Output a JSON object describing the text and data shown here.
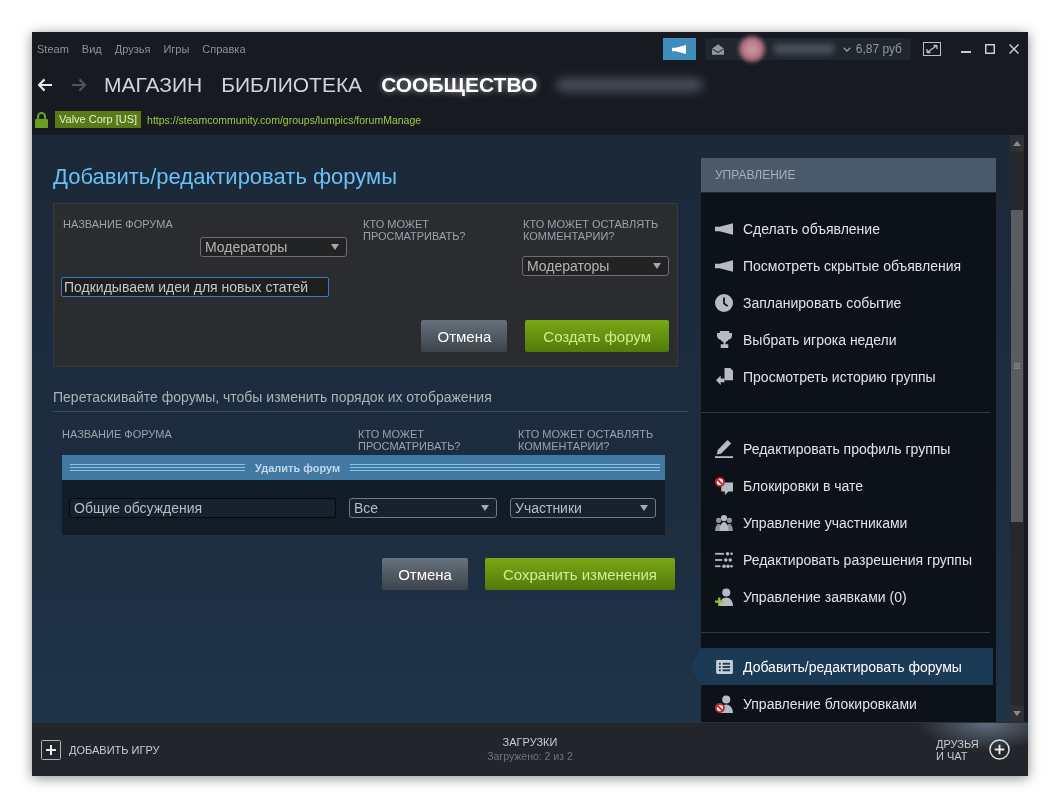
{
  "window": {
    "menu": [
      "Steam",
      "Вид",
      "Друзья",
      "Игры",
      "Справка"
    ],
    "balance": "6,87 руб"
  },
  "nav": {
    "history": [
      {
        "kind": "back",
        "disabled": false
      },
      {
        "kind": "forward",
        "disabled": true
      }
    ],
    "tabs": [
      {
        "label": "МАГАЗИН",
        "selected": false
      },
      {
        "label": "БИБЛИОТЕКА",
        "selected": false
      },
      {
        "label": "СООБЩЕСТВО",
        "selected": true
      }
    ]
  },
  "address": {
    "certificate": "Valve Corp [US]",
    "url": "https://steamcommunity.com/groups/lumpics/forumManage"
  },
  "page": {
    "title": "Добавить/редактировать форумы",
    "new_forum": {
      "columns": [
        "НАЗВАНИЕ ФОРУМА",
        "КТО МОЖЕТ ПРОСМАТРИВАТЬ?",
        "КТО МОЖЕТ ОСТАВЛЯТЬ КОММЕНТАРИИ?"
      ],
      "view_select": "Модераторы",
      "comment_select": "Модераторы",
      "name_value": "Подкидываем идеи для новых статей",
      "buttons": [
        {
          "label": "Отмена",
          "kind": "secondary"
        },
        {
          "label": "Создать форум",
          "kind": "primary"
        }
      ]
    },
    "reorder_hint": "Перетаскивайте форумы, чтобы изменить порядок их отображения",
    "forums": {
      "columns": [
        "НАЗВАНИЕ ФОРУМА",
        "КТО МОЖЕТ ПРОСМАТРИВАТЬ?",
        "КТО МОЖЕТ ОСТАВЛЯТЬ КОММЕНТАРИИ?"
      ],
      "rows": [
        {
          "delete_link": "Удалить форум",
          "name": "Общие обсуждения",
          "view": "Все",
          "comment": "Участники"
        }
      ],
      "buttons": [
        {
          "label": "Отмена",
          "kind": "secondary"
        },
        {
          "label": "Сохранить изменения",
          "kind": "primary"
        }
      ]
    }
  },
  "sidebar": {
    "title": "УПРАВЛЕНИЕ",
    "groups": [
      {
        "items": [
          {
            "label": "Сделать объявление",
            "selected": false
          },
          {
            "label": "Посмотреть скрытые объявления",
            "selected": false
          },
          {
            "label": "Запланировать событие",
            "selected": false
          },
          {
            "label": "Выбрать игрока недели",
            "selected": false
          },
          {
            "label": "Просмотреть историю группы",
            "selected": false
          }
        ]
      },
      {
        "items": [
          {
            "label": "Редактировать профиль группы",
            "selected": false
          },
          {
            "label": "Блокировки в чате",
            "selected": false
          },
          {
            "label": "Управление участниками",
            "selected": false
          },
          {
            "label": "Редактировать разрешения группы",
            "selected": false
          },
          {
            "label": "Управление заявками (0)",
            "selected": false
          }
        ]
      },
      {
        "items": [
          {
            "label": "Добавить/редактировать форумы",
            "selected": true
          },
          {
            "label": "Управление блокировками",
            "selected": false
          }
        ]
      }
    ]
  },
  "bottom_bar": {
    "add_game": "ДОБАВИТЬ ИГРУ",
    "downloads": "ЗАГРУЗКИ",
    "downloads_status": "Загружено: 2 из 2",
    "friends": "ДРУЗЬЯ И ЧАТ"
  }
}
